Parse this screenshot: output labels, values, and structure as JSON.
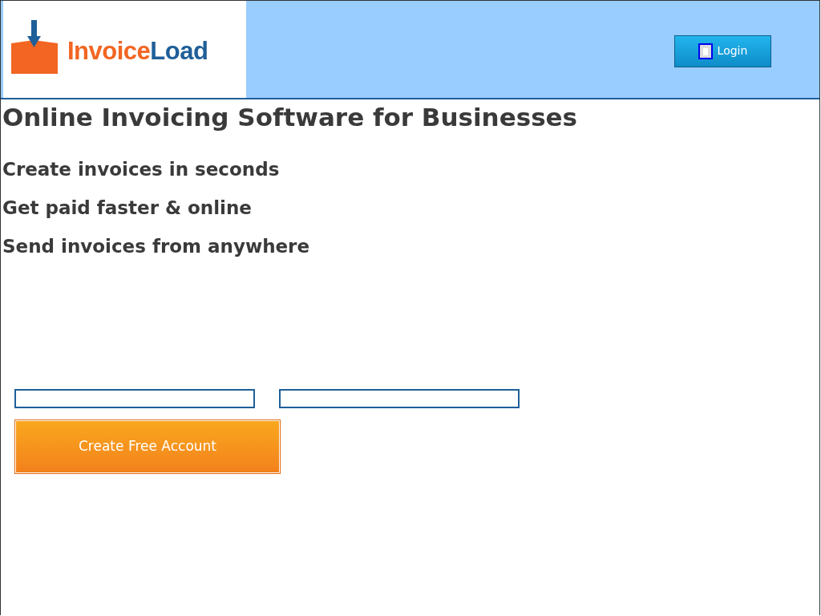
{
  "header": {
    "logo": {
      "parts": [
        {
          "text": "Invoice",
          "color": "#f26522"
        },
        {
          "text": "Load",
          "color": "#1f5f99"
        }
      ]
    },
    "login_button": "Login"
  },
  "headline": "Online Invoicing Software for Businesses",
  "features": [
    "Create invoices in seconds",
    "Get paid faster & online",
    "Send invoices from anywhere"
  ],
  "signup": {
    "fields": [
      {
        "kind": "text"
      },
      {
        "kind": "text"
      }
    ],
    "button": "Create Free Account"
  }
}
